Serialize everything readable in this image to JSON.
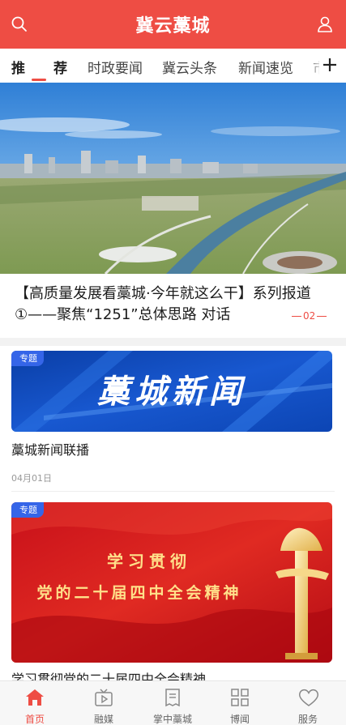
{
  "header": {
    "title": "冀云藁城",
    "search_icon": "search-icon",
    "user_icon": "user-icon",
    "bg_color": "#ee4d44"
  },
  "tabs": [
    {
      "label": "推"
    },
    {
      "label": "荐"
    },
    {
      "label": "时政要闻"
    },
    {
      "label": "冀云头条"
    },
    {
      "label": "新闻速览"
    },
    {
      "label": "市"
    }
  ],
  "active_tab": "推荐",
  "hero": {
    "caption": "【高质量发展看藁城·今年就这么干】系列报道①——聚焦“1251”总体思路 对话",
    "page_indicator": "02"
  },
  "cards": [
    {
      "tag": "专题",
      "banner_text": "藁城新闻",
      "title": "藁城新闻联播",
      "date": "04月01日"
    },
    {
      "tag": "专题",
      "banner_line1": "学习贯彻",
      "banner_line2": "党的二十届四中全会精神",
      "title": "学习贯彻党的二十届四中全会精神"
    }
  ],
  "bottom_nav": [
    {
      "label": "首页",
      "icon": "home-icon",
      "active": true
    },
    {
      "label": "融媒",
      "icon": "tv-play-icon",
      "active": false
    },
    {
      "label": "掌中藁城",
      "icon": "newspaper-icon",
      "active": false
    },
    {
      "label": "博闻",
      "icon": "grid-icon",
      "active": false
    },
    {
      "label": "服务",
      "icon": "heart-icon",
      "active": false
    }
  ],
  "accent_color": "#ee4d44"
}
